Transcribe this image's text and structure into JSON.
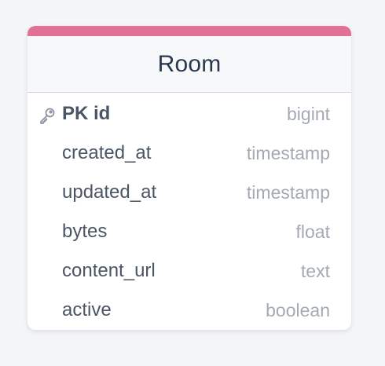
{
  "entity": {
    "name": "Room",
    "accent_color": "#e27196",
    "fields": [
      {
        "name": "PK id",
        "type": "bigint",
        "primary_key": true,
        "icon": "key-icon"
      },
      {
        "name": "created_at",
        "type": "timestamp"
      },
      {
        "name": "updated_at",
        "type": "timestamp"
      },
      {
        "name": "bytes",
        "type": "float"
      },
      {
        "name": "content_url",
        "type": "text"
      },
      {
        "name": "active",
        "type": "boolean"
      }
    ]
  }
}
